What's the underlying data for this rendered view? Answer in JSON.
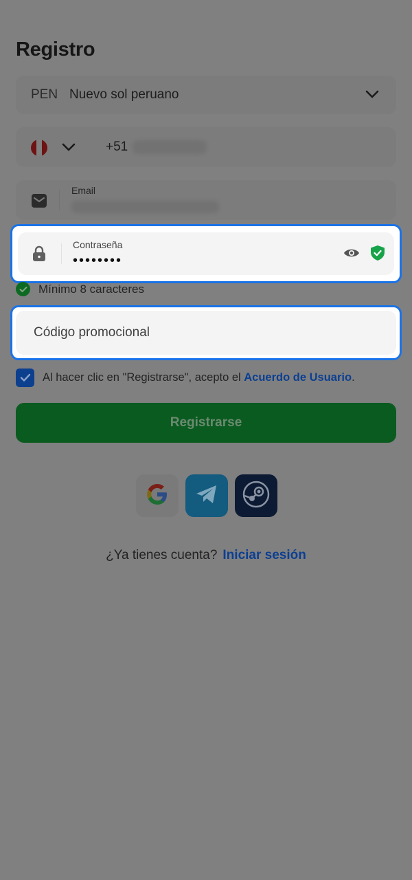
{
  "page": {
    "title": "Registro"
  },
  "currency": {
    "code": "PEN",
    "name": "Nuevo sol peruano"
  },
  "phone": {
    "prefix": "+51"
  },
  "email": {
    "label": "Email"
  },
  "password": {
    "label": "Contraseña",
    "value": "••••••••"
  },
  "password_hint": {
    "text": "Mínimo 8 caracteres"
  },
  "promo": {
    "placeholder": "Código promocional"
  },
  "agreement": {
    "text": "Al hacer clic en \"Registrarse\", acepto el ",
    "link": "Acuerdo de Usuario",
    "end": "."
  },
  "submit": {
    "label": "Registrarse"
  },
  "login": {
    "prompt": "¿Ya tienes cuenta?",
    "link": "Iniciar sesión"
  },
  "colors": {
    "accent": "#1a73e8",
    "submit": "#0a5b1f",
    "link": "#0c3f92",
    "overlay": "#808080"
  },
  "icons": [
    "chevron-down-icon",
    "peru-flag-icon",
    "mail-icon",
    "lock-icon",
    "eye-icon",
    "shield-check-icon",
    "check-icon",
    "google-icon",
    "telegram-icon",
    "steam-icon"
  ]
}
